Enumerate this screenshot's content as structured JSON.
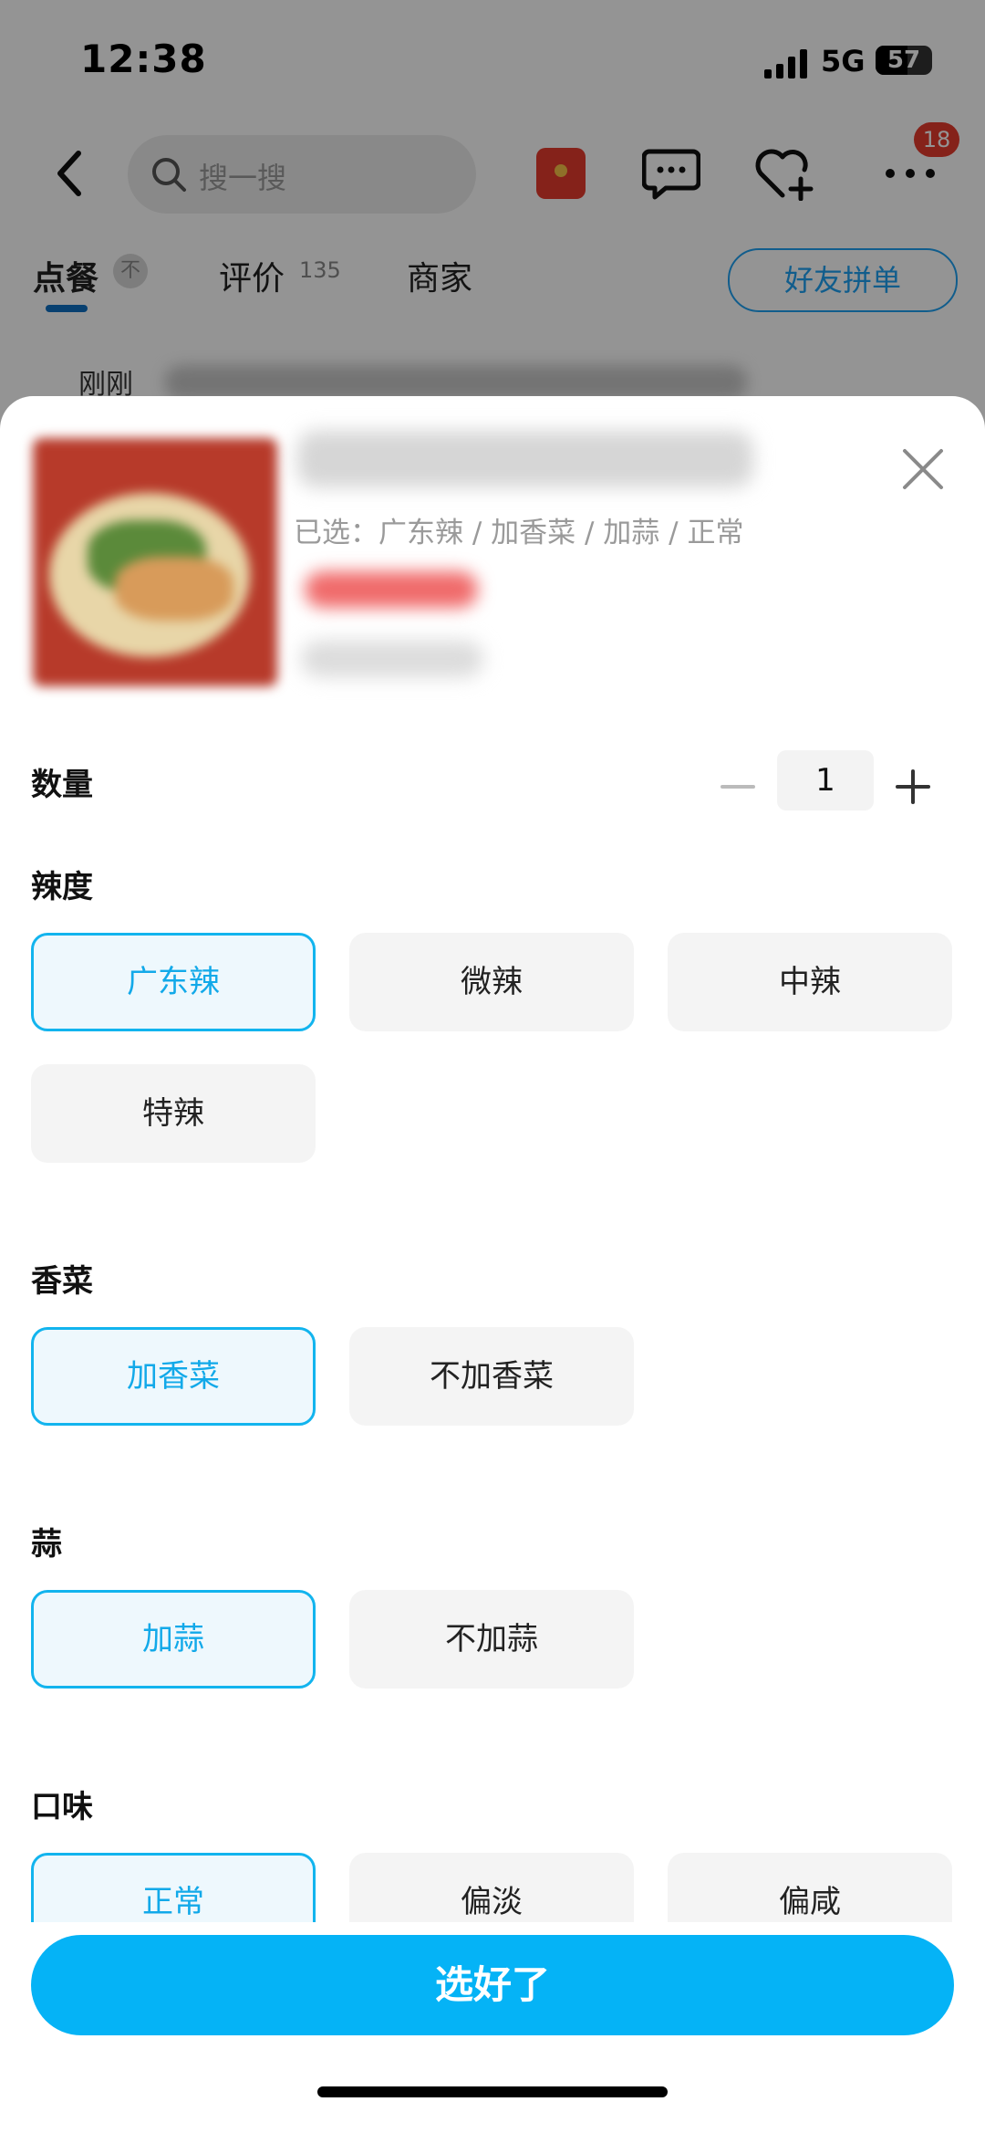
{
  "status_bar": {
    "time": "12:38",
    "network": "5G",
    "battery": "57"
  },
  "search": {
    "placeholder": "搜一搜"
  },
  "header": {
    "more_badge": "18"
  },
  "tabs": {
    "order": "点餐",
    "order_pin": "不",
    "reviews": "评价",
    "reviews_count": "135",
    "merchant": "商家",
    "group_order": "好友拼单"
  },
  "feed_peek": {
    "time": "刚刚"
  },
  "sheet": {
    "selected_summary": "已选：广东辣 / 加香菜 / 加蒜 / 正常",
    "quantity_label": "数量",
    "quantity_value": "1",
    "spice": {
      "label": "辣度",
      "options": [
        "广东辣",
        "微辣",
        "中辣",
        "特辣"
      ],
      "selected": "广东辣"
    },
    "coriander": {
      "label": "香菜",
      "options": [
        "加香菜",
        "不加香菜"
      ],
      "selected": "加香菜"
    },
    "garlic": {
      "label": "蒜",
      "options": [
        "加蒜",
        "不加蒜"
      ],
      "selected": "加蒜"
    },
    "flavor": {
      "label": "口味",
      "options": [
        "正常",
        "偏淡",
        "偏咸"
      ],
      "selected": "正常"
    },
    "confirm_label": "选好了"
  },
  "colors": {
    "accent": "#05b3f6",
    "selected_border": "#12b4ee",
    "selected_bg": "#eef8fd",
    "badge": "#e63b2e"
  }
}
